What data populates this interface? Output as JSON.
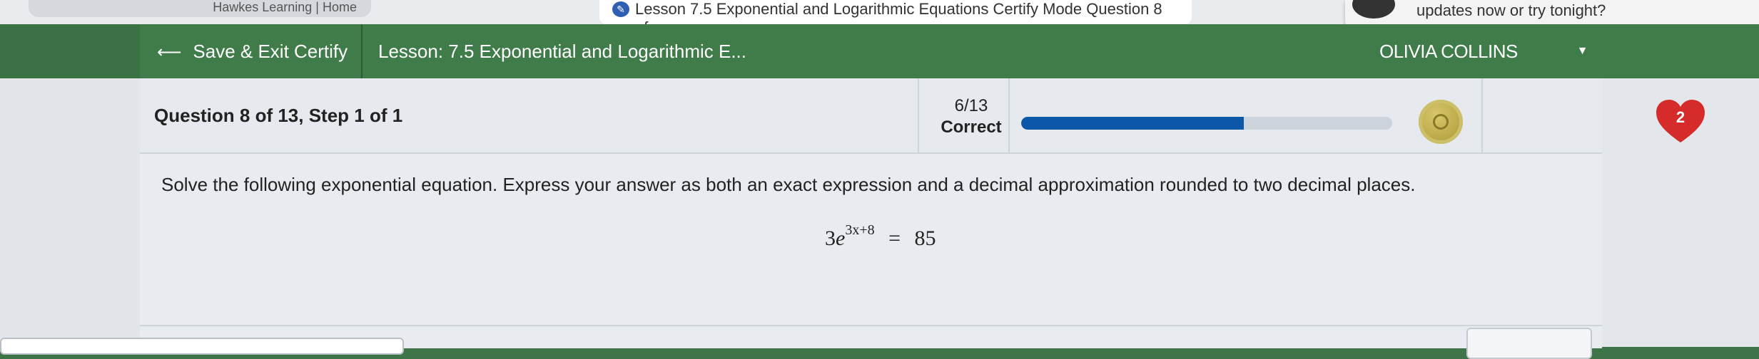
{
  "browser": {
    "tab_left_text": "Hawkes Learning | Home",
    "active_tab_title": "Lesson 7.5 Exponential and Logarithmic Equations Certify Mode Question 8 of...",
    "notification_text": "updates now or try tonight?"
  },
  "header": {
    "exit_label": "Save & Exit Certify",
    "lesson_title": "Lesson: 7.5 Exponential and Logarithmic E...",
    "user_name": "OLIVIA COLLINS"
  },
  "status": {
    "question_step": "Question 8 of 13, Step 1 of 1",
    "score_fraction": "6/13",
    "score_label": "Correct",
    "progress_fraction": 0.6,
    "lives": "2"
  },
  "question": {
    "prompt": "Solve the following exponential equation. Express your answer as both an exact expression and a decimal approximation rounded to two decimal places.",
    "equation": {
      "coefficient": "3",
      "base": "e",
      "exponent": "3x+8",
      "equals": "=",
      "rhs": "85"
    }
  },
  "colors": {
    "header_green": "#3f7c4a",
    "progress_blue": "#0c57a8",
    "heart_red": "#d52b2b"
  }
}
